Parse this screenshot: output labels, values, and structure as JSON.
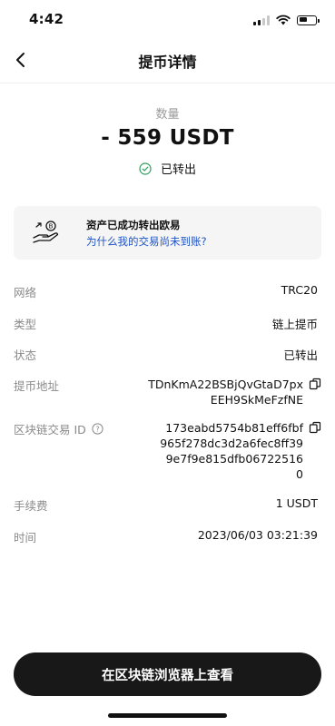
{
  "status_bar": {
    "time": "4:42"
  },
  "header": {
    "title": "提币详情"
  },
  "summary": {
    "amount_label": "数量",
    "amount": "- 559 USDT",
    "status_text": "已转出"
  },
  "notice": {
    "title": "资产已成功转出欧易",
    "link": "为什么我的交易尚未到账?"
  },
  "details": {
    "network": {
      "label": "网络",
      "value": "TRC20"
    },
    "type": {
      "label": "类型",
      "value": "链上提币"
    },
    "state": {
      "label": "状态",
      "value": "已转出"
    },
    "address": {
      "label": "提币地址",
      "value": "TDnKmA22BSBjQvGtaD7pxEEH9SkMeFzfNE"
    },
    "txid": {
      "label": "区块链交易 ID",
      "value": "173eabd5754b81eff6fbf965f278dc3d2a6fec8ff399e7f9e815dfb067225160"
    },
    "fee": {
      "label": "手续费",
      "value": "1 USDT"
    },
    "time": {
      "label": "时间",
      "value": "2023/06/03 03:21:39"
    }
  },
  "footer": {
    "explorer_button": "在区块链浏览器上查看"
  },
  "colors": {
    "link": "#1f54c7",
    "success": "#2e9e5b",
    "button_bg": "#181818"
  },
  "icons": [
    "back-arrow-icon",
    "check-circle-icon",
    "hand-coin-icon",
    "copy-icon",
    "help-icon"
  ]
}
